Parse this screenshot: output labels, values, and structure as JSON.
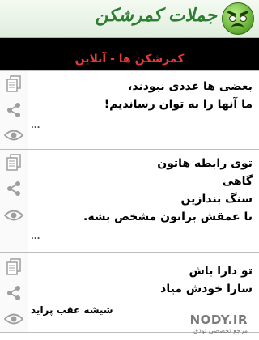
{
  "header": {
    "title": "جملات کمرشکن"
  },
  "online_bar": {
    "title": "کمرشکن ها - آنلاین"
  },
  "posts": [
    {
      "lines": [
        "بعضی ها عددی نبودند،",
        "ما آنها را به توان رساندیم!"
      ],
      "more": "..."
    },
    {
      "lines": [
        "توی رابطه هاتون",
        "گاهی",
        "سنگ بندازین",
        "تا عمقش براتون مشخص بشه."
      ],
      "more": "..."
    },
    {
      "lines": [
        "تو دارا باش",
        "سارا خودش میاد"
      ],
      "more": "شیشه عقب پراید"
    }
  ],
  "watermark": {
    "brand": "NODY.IR",
    "tagline": "مرجع تخصصی نودی"
  },
  "icons": {
    "copy": "copy-icon",
    "share": "share-icon",
    "view": "eye-icon"
  },
  "colors": {
    "accent_red": "#e53935",
    "header_green": "#2e7d32",
    "icon_gray": "#9e9e9e"
  }
}
